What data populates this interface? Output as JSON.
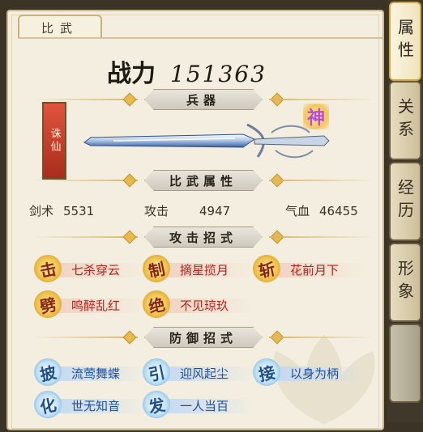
{
  "header": {
    "tab_label": "比武"
  },
  "power": {
    "label": "战力",
    "value": "151363"
  },
  "sections": {
    "weapon": "兵器",
    "attributes": "比武属性",
    "attack_skills": "攻击招式",
    "defense_skills": "防御招式"
  },
  "weapon": {
    "name": "诛仙",
    "grade_badge": "神"
  },
  "attributes": [
    {
      "label": "剑术",
      "value": "5531"
    },
    {
      "label": "攻击",
      "value": "4947"
    },
    {
      "label": "气血",
      "value": "46455"
    }
  ],
  "attack_skills": [
    {
      "glyph": "击",
      "name": "七杀穿云"
    },
    {
      "glyph": "制",
      "name": "摘星揽月"
    },
    {
      "glyph": "斩",
      "name": "花前月下"
    },
    {
      "glyph": "劈",
      "name": "鸣醉乱红"
    },
    {
      "glyph": "绝",
      "name": "不见琼玖"
    }
  ],
  "defense_skills": [
    {
      "glyph": "披",
      "name": "流莺舞蝶"
    },
    {
      "glyph": "引",
      "name": "迎风起尘"
    },
    {
      "glyph": "接",
      "name": "以身为柄"
    },
    {
      "glyph": "化",
      "name": "世无知音"
    },
    {
      "glyph": "发",
      "name": "一人当百"
    }
  ],
  "side_tabs": [
    {
      "label": "属性",
      "state": "active"
    },
    {
      "label": "关系",
      "state": "normal"
    },
    {
      "label": "经历",
      "state": "normal"
    },
    {
      "label": "形象",
      "state": "normal"
    },
    {
      "label": "",
      "state": "dim"
    }
  ],
  "colors": {
    "attack_text": "#b5221b",
    "defense_text": "#1d4f9a",
    "panel_bg": "#f3eedf",
    "accent_gold": "#d9b667"
  }
}
